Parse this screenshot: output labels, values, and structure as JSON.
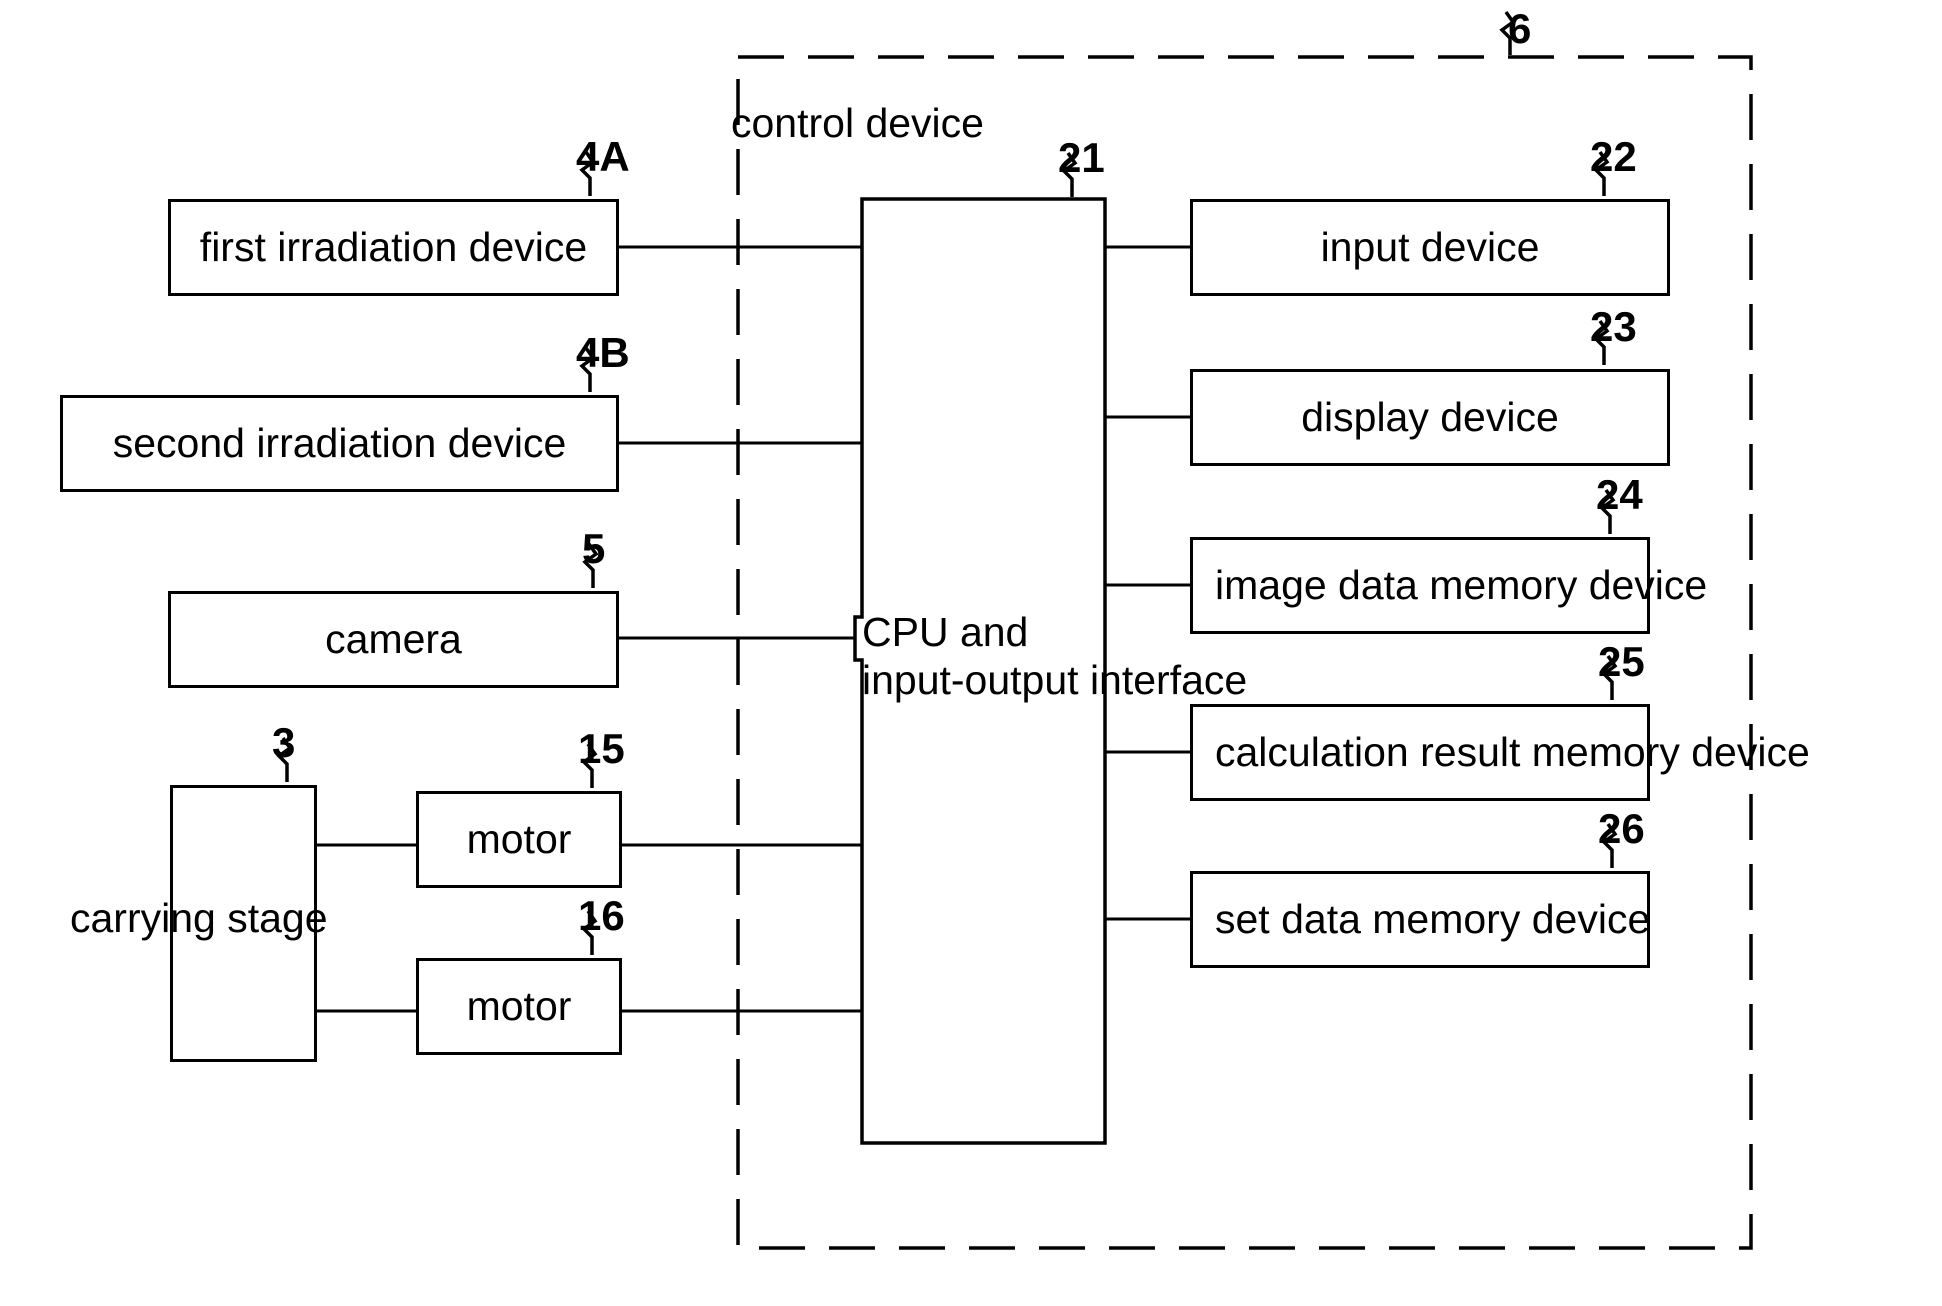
{
  "diagram": {
    "title_note": "control device block diagram",
    "control_device": {
      "label": "control device",
      "ref": "6"
    },
    "cpu": {
      "line1": "CPU and",
      "line2": "input-output interface",
      "ref": "21"
    },
    "left_blocks": [
      {
        "label": "first irradiation device",
        "ref": "4A"
      },
      {
        "label": "second irradiation device",
        "ref": "4B"
      },
      {
        "label": "camera",
        "ref": "5"
      }
    ],
    "stage": {
      "label": "carrying stage",
      "ref": "3"
    },
    "motors": [
      {
        "label": "motor",
        "ref": "15"
      },
      {
        "label": "motor",
        "ref": "16"
      }
    ],
    "right_blocks": [
      {
        "label": "input device",
        "ref": "22"
      },
      {
        "label": "display device",
        "ref": "23"
      },
      {
        "label": "image data memory device",
        "ref": "24"
      },
      {
        "label": "calculation result memory device",
        "ref": "25"
      },
      {
        "label": "set data memory device",
        "ref": "26"
      }
    ]
  }
}
